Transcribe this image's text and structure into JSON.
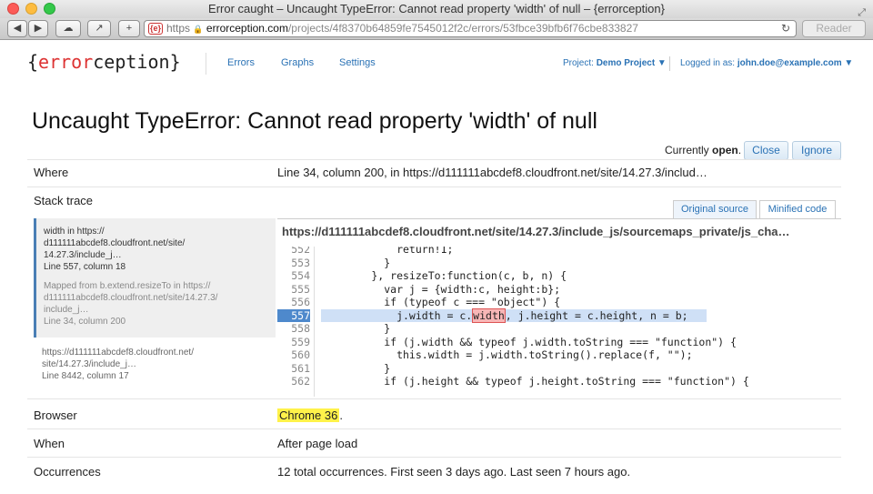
{
  "window": {
    "title": "Error caught – Uncaught TypeError: Cannot read property 'width' of null – {errorception}"
  },
  "toolbar": {
    "back": "◀",
    "forward": "▶",
    "cloud": "☁",
    "share": "↗",
    "add": "+",
    "favicon": "{e}",
    "https": "https",
    "lock": "🔒",
    "host": "errorception.com",
    "path": "/projects/4f8370b64859fe7545012f2c/errors/53fbce39bfb6f76cbe833827",
    "reload": "↻",
    "reader": "Reader"
  },
  "header": {
    "logo_brace_open": "{",
    "logo_red": "error",
    "logo_rest": "ception",
    "logo_brace_close": "}",
    "nav": [
      "Errors",
      "Graphs",
      "Settings"
    ],
    "project_label": "Project:",
    "project_name": "Demo Project ▼",
    "logged_in_label": "Logged in as:",
    "user": "john.doe@example.com ▼"
  },
  "error": {
    "title": "Uncaught TypeError: Cannot read property 'width' of null",
    "status_prefix": "Currently",
    "status": "open",
    "close_label": "Close",
    "ignore_label": "Ignore"
  },
  "details": {
    "where_label": "Where",
    "where_value": "Line 34, column 200, in https://d111111abcdef8.cloudfront.net/site/14.27.3/includ…",
    "stack_label": "Stack trace",
    "tab_original": "Original source",
    "tab_minified": "Minified code",
    "frame1": {
      "line1": "width in https://",
      "line2": "d111111abcdef8.cloudfront.net/site/",
      "line3": "14.27.3/include_j…",
      "line4": "Line 557, column 18",
      "mapped1": "Mapped from b.extend.resizeTo in https://",
      "mapped2": "d111111abcdef8.cloudfront.net/site/14.27.3/",
      "mapped3": "include_j…",
      "mapped4": "Line 34, column 200"
    },
    "frame2": {
      "line1": "https://d111111abcdef8.cloudfront.net/",
      "line2": "site/14.27.3/include_j…",
      "line3": "Line 8442, column 17"
    },
    "file_path": "https://d111111abcdef8.cloudfront.net/site/14.27.3/include_js/sourcemaps_private/js_cha…",
    "code": [
      {
        "ln": "552",
        "src": "            return!1;"
      },
      {
        "ln": "553",
        "src": "          }"
      },
      {
        "ln": "554",
        "src": "        }, resizeTo:function(c, b, n) {"
      },
      {
        "ln": "555",
        "src": "          var j = {width:c, height:b};"
      },
      {
        "ln": "556",
        "src": "          if (typeof c === \"object\") {"
      },
      {
        "ln": "557",
        "src_pre": "            j.width = c.",
        "token": "width",
        "src_post": ", j.height = c.height, n = b;"
      },
      {
        "ln": "558",
        "src": "          }"
      },
      {
        "ln": "559",
        "src": "          if (j.width && typeof j.width.toString === \"function\") {"
      },
      {
        "ln": "560",
        "src": "            this.width = j.width.toString().replace(f, \"\");"
      },
      {
        "ln": "561",
        "src": "          }"
      },
      {
        "ln": "562",
        "src": "          if (j.height && typeof j.height.toString === \"function\") {"
      }
    ],
    "browser_label": "Browser",
    "browser_value": "Chrome 36",
    "browser_suffix": ".",
    "when_label": "When",
    "when_value": "After page load",
    "occurrences_label": "Occurrences",
    "occurrences_value": "12 total occurrences. First seen 3 days ago. Last seen 7 hours ago."
  }
}
